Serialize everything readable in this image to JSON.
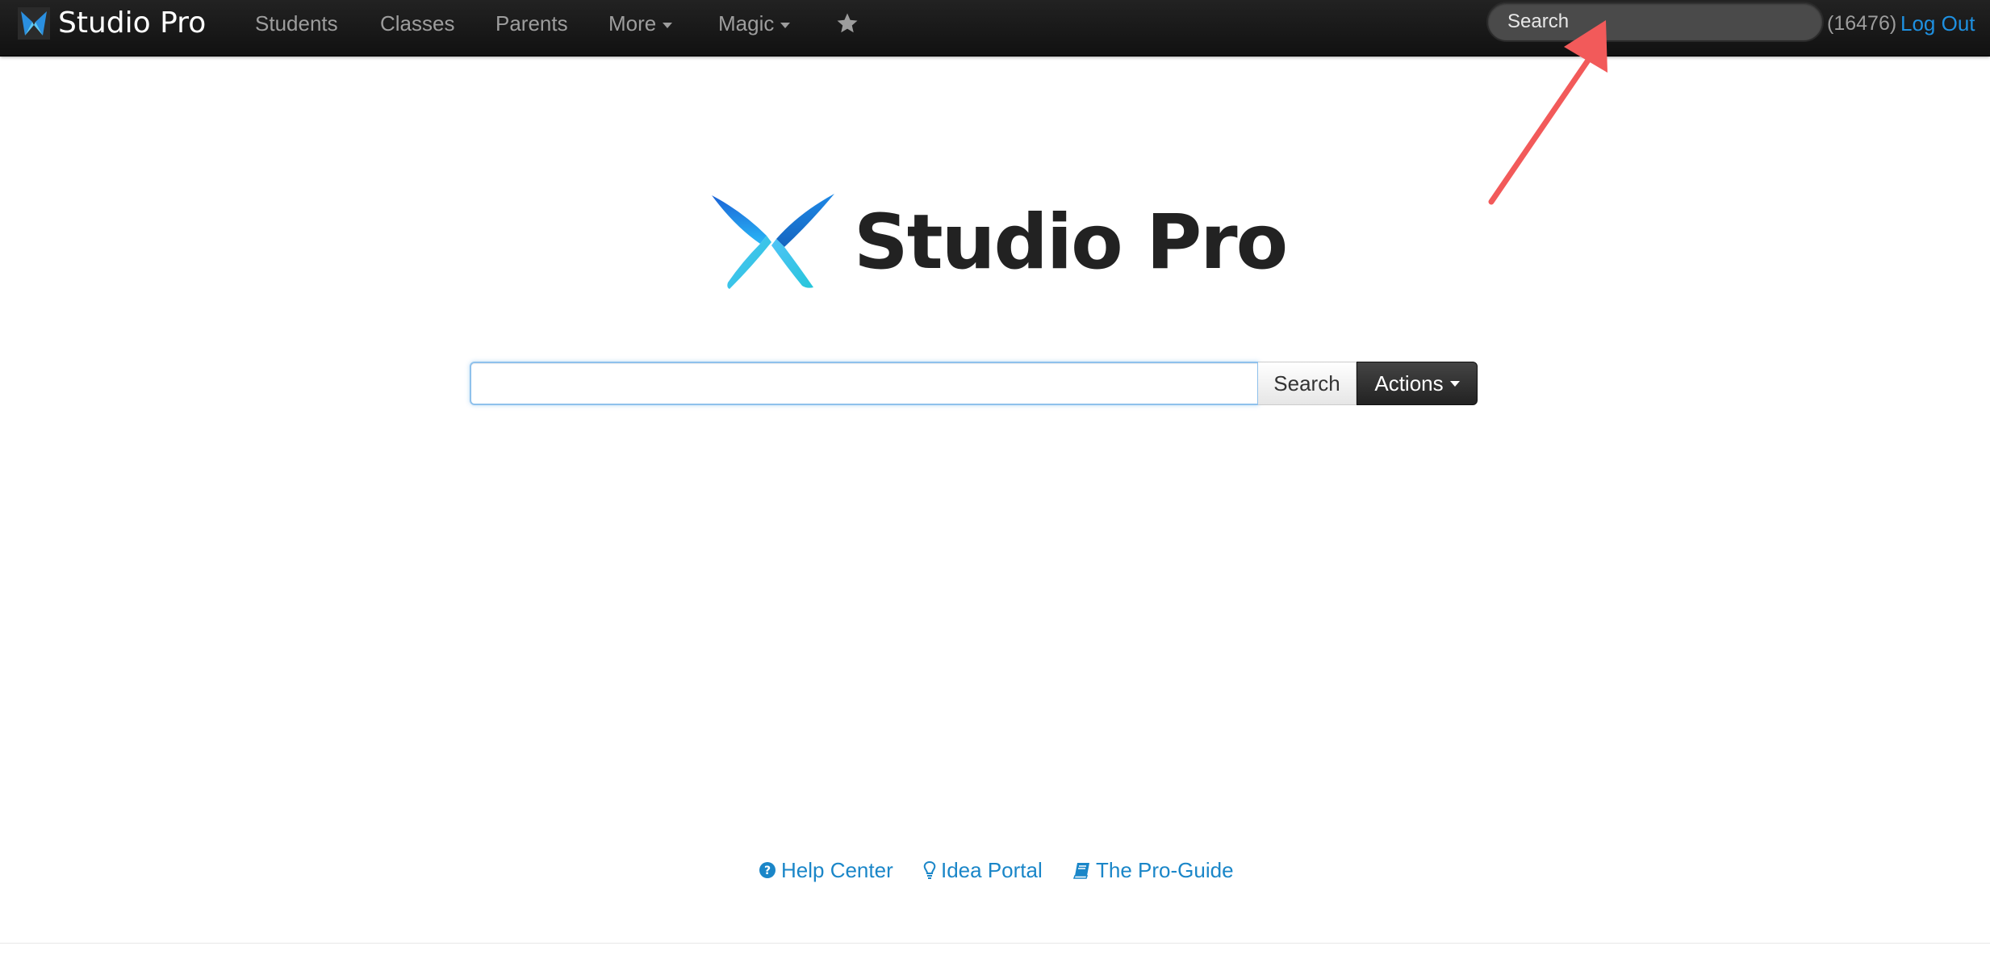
{
  "navbar": {
    "brand": "Studio Pro",
    "items": [
      {
        "label": "Students"
      },
      {
        "label": "Classes"
      },
      {
        "label": "Parents"
      },
      {
        "label": "More"
      },
      {
        "label": "Magic"
      }
    ],
    "favorites_icon": "star-icon",
    "search_placeholder": "Search",
    "user_count": "(16476)",
    "logout_label": "Log Out"
  },
  "logo": {
    "text": "Studio Pro"
  },
  "search": {
    "value": "",
    "button_label": "Search",
    "actions_label": "Actions"
  },
  "footer": {
    "links": [
      {
        "label": "Help Center",
        "icon": "question-circle-icon"
      },
      {
        "label": "Idea Portal",
        "icon": "lightbulb-icon"
      },
      {
        "label": "The Pro-Guide",
        "icon": "book-icon"
      }
    ]
  },
  "colors": {
    "navbar_bg": "#1a1a1a",
    "link": "#1a86c8",
    "logout": "#1e90e0",
    "annotation_arrow": "#f25a5a",
    "logo_blue": "#1e88e5"
  }
}
